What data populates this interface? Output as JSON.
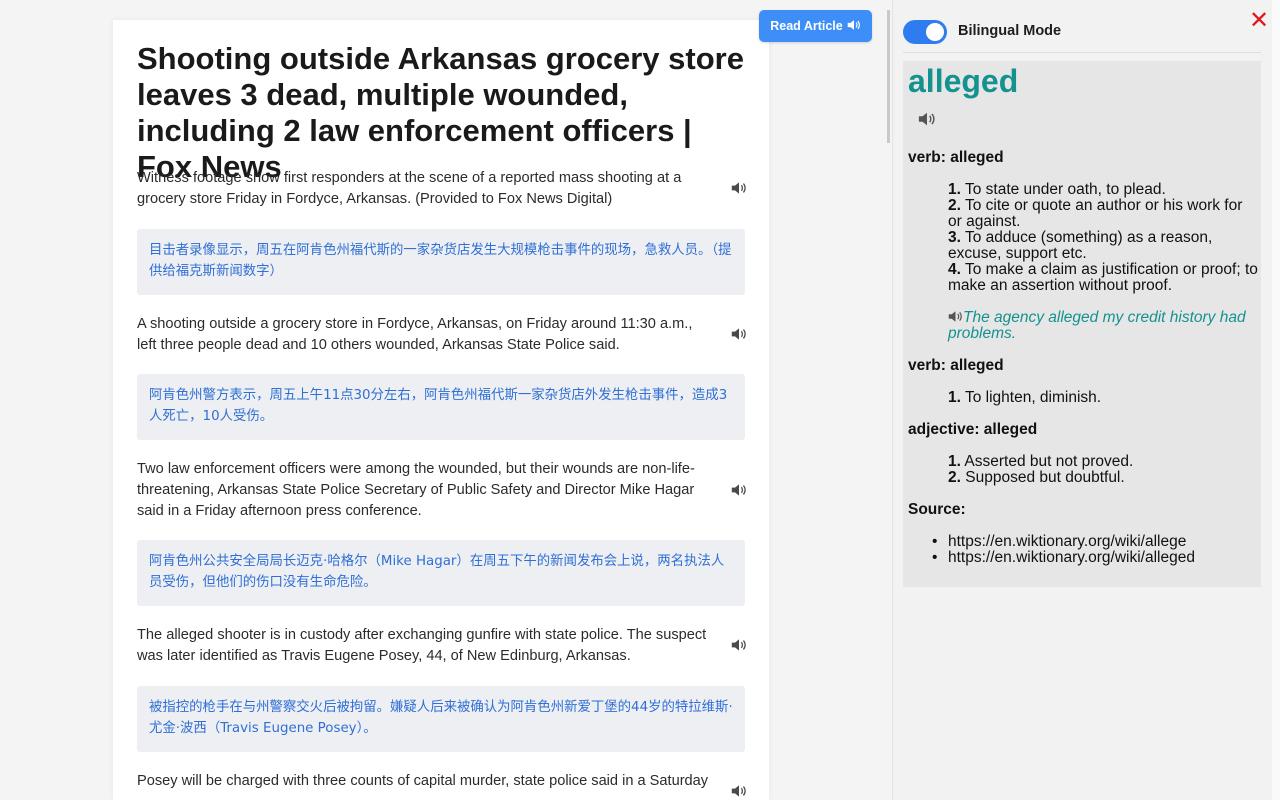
{
  "article": {
    "headline": "Shooting outside Arkansas grocery store leaves 3 dead, multiple wounded, including 2 law enforcement officers | Fox News",
    "paragraphs": [
      {
        "text": "Witness footage show first responders at the scene of a reported mass shooting at a grocery store Friday in Fordyce, Arkansas. (Provided to Fox News Digital)",
        "translation": "目击者录像显示，周五在阿肯色州福代斯的一家杂货店发生大规模枪击事件的现场，急救人员。（提供给福克斯新闻数字）"
      },
      {
        "text": "A shooting outside a grocery store in Fordyce, Arkansas, on Friday around 11:30 a.m., left three people dead and 10 others wounded, Arkansas State Police said.",
        "translation": "阿肯色州警方表示，周五上午11点30分左右，阿肯色州福代斯一家杂货店外发生枪击事件，造成3人死亡，10人受伤。"
      },
      {
        "text": "Two law enforcement officers were among the wounded, but their wounds are non-life-threatening, Arkansas State Police Secretary of Public Safety and Director Mike Hagar said in a Friday afternoon press conference.",
        "translation": "阿肯色州公共安全局局长迈克·哈格尔（Mike Hagar）在周五下午的新闻发布会上说，两名执法人员受伤，但他们的伤口没有生命危险。"
      },
      {
        "text": "The alleged shooter is in custody after exchanging gunfire with state police. The suspect was later identified as Travis Eugene Posey, 44, of New Edinburg, Arkansas.",
        "translation": "被指控的枪手在与州警察交火后被拘留。嫌疑人后来被确认为阿肯色州新爱丁堡的44岁的特拉维斯·尤金·波西（Travis Eugene Posey）。"
      },
      {
        "text": "Posey will be charged with three counts of capital murder, state police said in a Saturday"
      }
    ]
  },
  "toolbar": {
    "read_article_label": "Read Article",
    "speaker_icon": "speaker-icon"
  },
  "panel": {
    "bilingual_label": "Bilingual Mode",
    "bilingual_on": true,
    "close_symbol": "✕",
    "word": "alleged",
    "sections": [
      {
        "pos": "verb: alleged",
        "definitions": [
          {
            "num": "1.",
            "text": "To state under oath, to plead."
          },
          {
            "num": "2.",
            "text": "To cite or quote an author or his work for or against."
          },
          {
            "num": "3.",
            "text": "To adduce (something) as a reason, excuse, support etc."
          },
          {
            "num": "4.",
            "text": "To make a claim as justification or proof; to make an assertion without proof."
          }
        ],
        "example": "The agency alleged my credit history had problems."
      },
      {
        "pos": "verb: alleged",
        "definitions": [
          {
            "num": "1.",
            "text": "To lighten, diminish."
          }
        ]
      },
      {
        "pos": "adjective: alleged",
        "definitions": [
          {
            "num": "1.",
            "text": "Asserted but not proved."
          },
          {
            "num": "2.",
            "text": "Supposed but doubtful."
          }
        ]
      }
    ],
    "source_label": "Source:",
    "sources": [
      "https://en.wiktionary.org/wiki/allege",
      "https://en.wiktionary.org/wiki/alleged"
    ]
  },
  "colors": {
    "accent_blue": "#3d8ef7",
    "translation_blue": "#2f6fd6",
    "dict_teal": "#149290",
    "close_red": "#e0181b"
  }
}
